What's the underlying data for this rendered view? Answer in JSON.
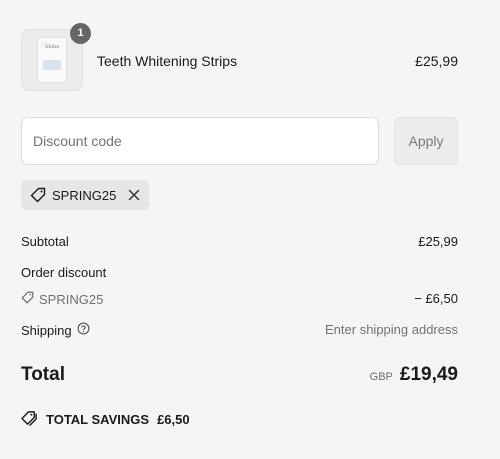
{
  "line_item": {
    "quantity": "1",
    "name": "Teeth Whitening Strips",
    "price": "£25,99",
    "thumbnail_brand_text": "Shine"
  },
  "discount": {
    "placeholder": "Discount code",
    "apply_label": "Apply",
    "applied_code": "SPRING25"
  },
  "summary": {
    "subtotal_label": "Subtotal",
    "subtotal_value": "£25,99",
    "order_discount_label": "Order discount",
    "discount_code": "SPRING25",
    "discount_value": "− £6,50",
    "shipping_label": "Shipping",
    "shipping_value": "Enter shipping address",
    "total_label": "Total",
    "currency": "GBP",
    "total_value": "£19,49"
  },
  "savings": {
    "label": "TOTAL SAVINGS",
    "value": "£6,50"
  },
  "icons": {
    "tag": "tag-icon",
    "close": "close-icon",
    "help": "question-circle-icon",
    "savings": "tags-icon"
  },
  "colors": {
    "background": "#f5f5f5",
    "badge": "#666666",
    "chip": "#e6e6e6",
    "muted_text": "#737373"
  }
}
